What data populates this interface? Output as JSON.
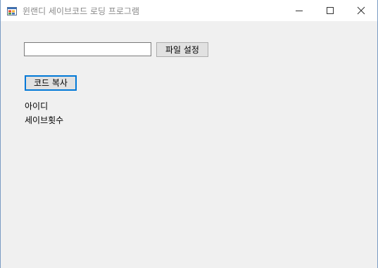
{
  "window": {
    "title": "윈랜디 세이브코드 로딩 프로그램",
    "icon": "app-form-icon"
  },
  "controls": {
    "minimize_icon": "minimize-icon",
    "maximize_icon": "maximize-icon",
    "close_icon": "close-icon"
  },
  "form": {
    "file_path": {
      "value": "",
      "placeholder": ""
    },
    "file_button_label": "파일 설정",
    "copy_button_label": "코드 복사",
    "id_label": "아이디",
    "save_count_label": "세이브횟수"
  },
  "colors": {
    "focus_border": "#0078d7",
    "client_background": "#f0f0f0",
    "title_text": "#8a8a8a"
  }
}
